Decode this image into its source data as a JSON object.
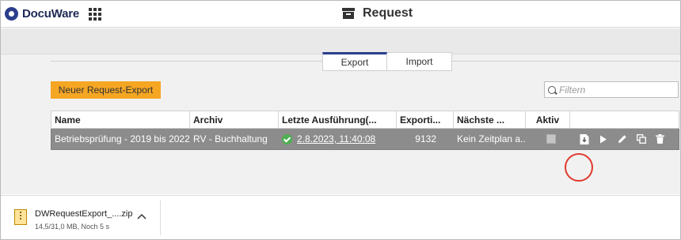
{
  "app": {
    "name": "DocuWare"
  },
  "header": {
    "title": "Request"
  },
  "tabs": [
    {
      "label": "Export",
      "active": true
    },
    {
      "label": "Import",
      "active": false
    }
  ],
  "toolbar": {
    "new_button": "Neuer Request-Export",
    "filter_placeholder": "Filtern"
  },
  "table": {
    "columns": [
      "Name",
      "Archiv",
      "Letzte Ausführung(...",
      "Exporti...",
      "Nächste ...",
      "Aktiv",
      ""
    ],
    "rows": [
      {
        "name": "Betriebsprüfung - 2019 bis 2022",
        "archiv": "RV - Buchhaltung",
        "last_run": "2.8.2023, 11:40:08",
        "last_run_status": "success",
        "exported": "9132",
        "next": "Kein Zeitplan a...",
        "aktiv": false,
        "actions": [
          "download-icon",
          "play-icon",
          "edit-icon",
          "copy-icon",
          "delete-icon"
        ]
      }
    ]
  },
  "download": {
    "filename": "DWRequestExport_....zip",
    "status": "14,5/31,0 MB, Noch 5 s"
  },
  "colors": {
    "brand": "#2c3e8c",
    "accent": "#f5a623",
    "row_selected": "#8c8c8c",
    "highlight": "#e03a2e",
    "success": "#4caf50"
  }
}
